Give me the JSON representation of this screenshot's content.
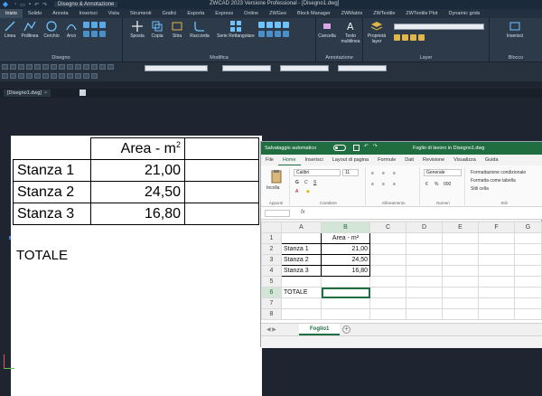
{
  "titlebar": {
    "workspace": "Disegno & Annotazione",
    "doc_title": "ZWCAD 2023 Versione Professional - [Disegno1.dwg]"
  },
  "ribbon_tabs": [
    "Inizio",
    "Solido",
    "Annota",
    "Inserisci",
    "Vista",
    "Strumenti",
    "Grafici",
    "Esporta",
    "Express",
    "Online",
    "ZWGeo",
    "Block Manager",
    "ZWMatrix",
    "ZWTextile",
    "ZWTextile Plot",
    "Dynamic grids"
  ],
  "ribbon": {
    "disegno_buttons": [
      "Linea",
      "Polilinea",
      "Cerchio",
      "Arco"
    ],
    "modifica_buttons": [
      "Sposta",
      "Copia",
      "Stira",
      "Raccorda",
      "Serie Rettangolare"
    ],
    "annotazione_buttons": [
      "Cancella",
      "Testo multilinea"
    ],
    "layer_buttons": [
      "Proprietà layer"
    ],
    "blocco_buttons": [
      "Inserisci"
    ],
    "panel_titles": [
      "Disegno",
      "Modifica",
      "Annotazione",
      "Layer",
      "Blocco"
    ]
  },
  "doc_tab": {
    "label": "[Disegno1.dwg]",
    "close": "×"
  },
  "cad_table": {
    "header": "Area - m",
    "header_sup": "2",
    "rows": [
      {
        "label": "Stanza 1",
        "value": "21,00"
      },
      {
        "label": "Stanza 2",
        "value": "24,50"
      },
      {
        "label": "Stanza 3",
        "value": "16,80"
      }
    ],
    "total_label": "TOTALE"
  },
  "excel": {
    "autosave": "Salvataggio automatico",
    "title": "Foglio di lavoro in Disegno1.dwg",
    "menu": [
      "File",
      "Home",
      "Inserisci",
      "Layout di pagina",
      "Formule",
      "Dati",
      "Revisione",
      "Visualizza",
      "Guida"
    ],
    "ribbon": {
      "incolla": "Incolla",
      "font": "Calibri",
      "font_size": "11",
      "number_format": "Generale",
      "groups": [
        "Appunti",
        "Carattere",
        "Allineamento",
        "Numeri",
        "Stili"
      ],
      "stili_items": [
        "Formattazione condizionale",
        "Formatta come tabella",
        "Stili cella"
      ]
    },
    "columns": [
      "",
      "A",
      "B",
      "C",
      "D",
      "E",
      "F",
      "G"
    ],
    "grid": [
      [
        "1",
        "",
        "Area - m²",
        "",
        "",
        "",
        "",
        ""
      ],
      [
        "2",
        "Stanza 1",
        "21,00",
        "",
        "",
        "",
        "",
        ""
      ],
      [
        "3",
        "Stanza 2",
        "24,50",
        "",
        "",
        "",
        "",
        ""
      ],
      [
        "4",
        "Stanza 3",
        "16,80",
        "",
        "",
        "",
        "",
        ""
      ],
      [
        "5",
        "",
        "",
        "",
        "",
        "",
        "",
        ""
      ],
      [
        "6",
        "TOTALE",
        "",
        "",
        "",
        "",
        "",
        ""
      ],
      [
        "7",
        "",
        "",
        "",
        "",
        "",
        "",
        ""
      ],
      [
        "8",
        "",
        "",
        "",
        "",
        "",
        "",
        ""
      ]
    ],
    "sheet_tab": "Foglio1",
    "add_sheet": "+"
  }
}
